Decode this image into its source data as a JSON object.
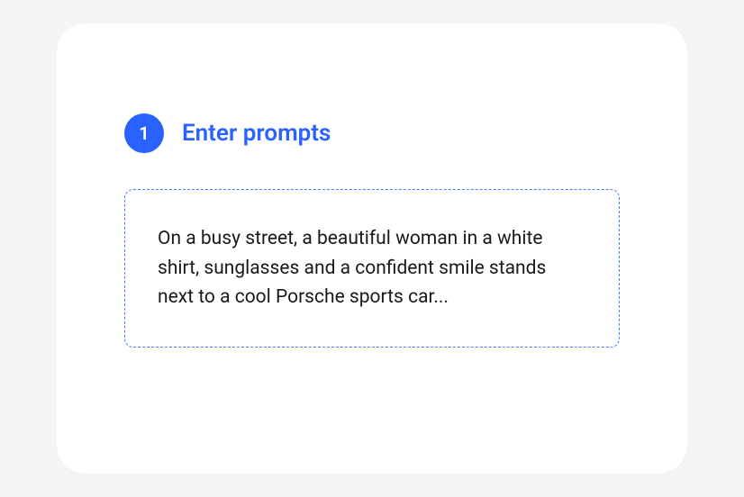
{
  "step": {
    "number": "1",
    "title": "Enter prompts"
  },
  "prompt": {
    "text": "On a busy street, a beautiful woman in a white shirt, sunglasses and a confident smile stands next to a cool Porsche sports car..."
  }
}
